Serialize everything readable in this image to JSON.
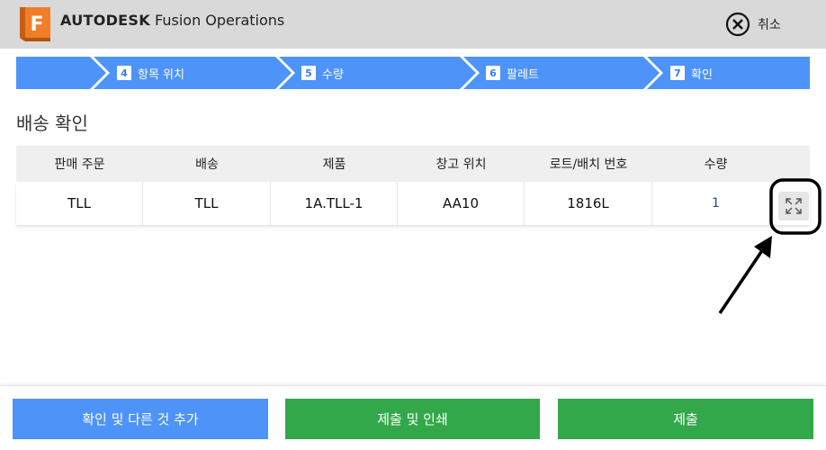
{
  "header": {
    "brand_bold": "AUTODESK",
    "brand_rest": " Fusion Operations",
    "logo_letter": "F",
    "cancel_label": "취소",
    "colors": {
      "header_bg": "#d9d9d9",
      "logo_orange": "#f07d28"
    }
  },
  "stepper": {
    "color": "#4d93f8",
    "steps": [
      {
        "num": "",
        "label": ""
      },
      {
        "num": "4",
        "label": "항목 위치"
      },
      {
        "num": "5",
        "label": "수량"
      },
      {
        "num": "6",
        "label": "팔레트"
      },
      {
        "num": "7",
        "label": "확인"
      }
    ]
  },
  "page_title": "배송 확인",
  "table": {
    "columns": [
      "판매 주문",
      "배송",
      "제품",
      "창고 위치",
      "로트/배치 번호",
      "수량"
    ],
    "rows": [
      {
        "sales_order": "TLL",
        "shipment": "TLL",
        "product": "1A.TLL-1",
        "location": "AA10",
        "lot": "1816L",
        "qty": "1"
      }
    ],
    "expand_icon": "expand-arrows-icon"
  },
  "footer": {
    "confirm_add_label": "확인 및 다른 것 추가",
    "submit_print_label": "제출 및 인쇄",
    "submit_label": "제출",
    "colors": {
      "blue": "#4d93f8",
      "green": "#33a84a"
    }
  }
}
